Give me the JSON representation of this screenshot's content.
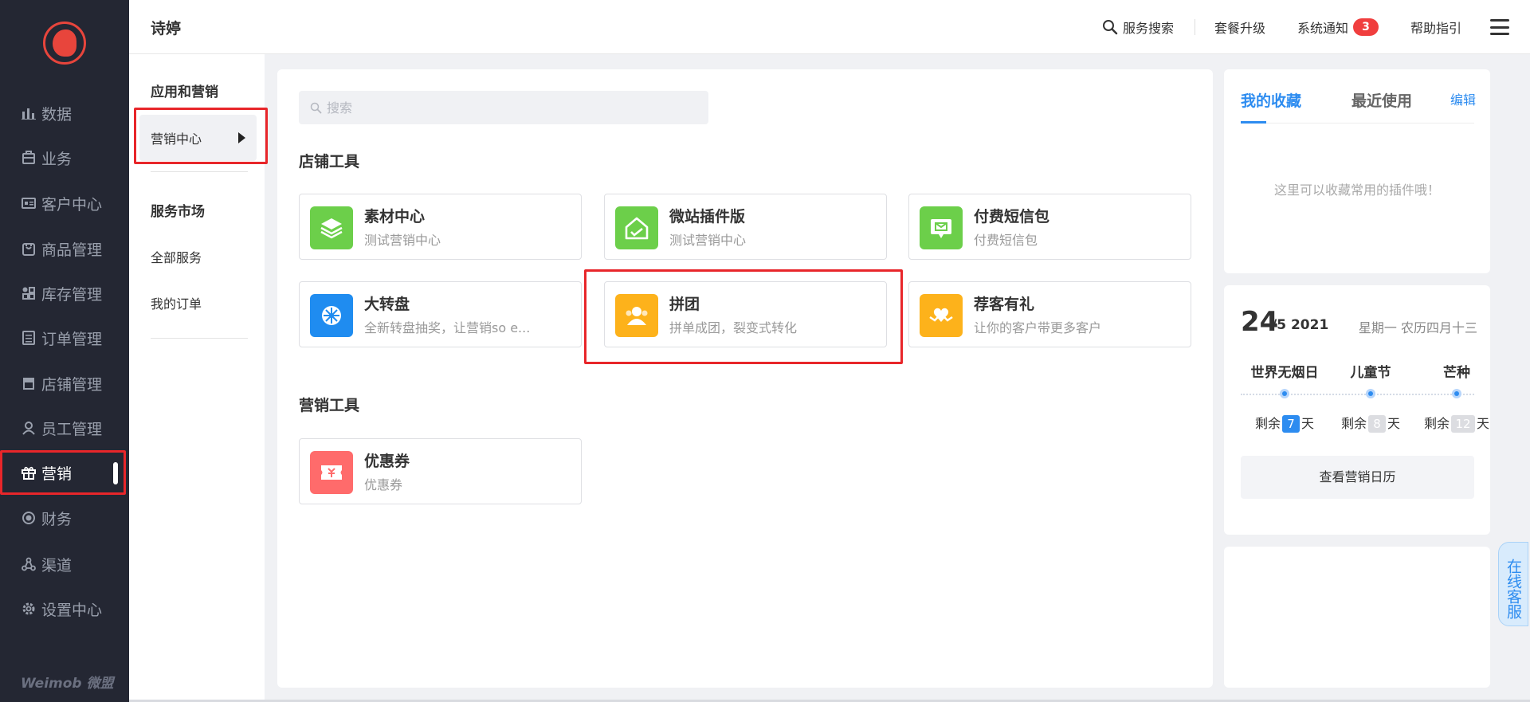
{
  "sidebar": {
    "items": [
      {
        "label": "数据",
        "icon": "bar-chart-icon"
      },
      {
        "label": "业务",
        "icon": "briefcase-icon"
      },
      {
        "label": "客户中心",
        "icon": "id-card-icon"
      },
      {
        "label": "商品管理",
        "icon": "bag-icon"
      },
      {
        "label": "库存管理",
        "icon": "grid-icon"
      },
      {
        "label": "订单管理",
        "icon": "list-icon"
      },
      {
        "label": "店铺管理",
        "icon": "store-icon"
      },
      {
        "label": "员工管理",
        "icon": "person-icon"
      },
      {
        "label": "营销",
        "icon": "gift-icon"
      },
      {
        "label": "财务",
        "icon": "coin-icon"
      },
      {
        "label": "渠道",
        "icon": "channel-icon"
      },
      {
        "label": "设置中心",
        "icon": "gear-icon"
      }
    ],
    "active_label": "营销",
    "brand": "Weimob 微盟"
  },
  "topbar": {
    "shop_name": "诗婷",
    "search_label": "服务搜索",
    "upgrade_label": "套餐升级",
    "notice_label": "系统通知",
    "notice_count": "3",
    "help_label": "帮助指引"
  },
  "subnav": {
    "group1_title": "应用和营销",
    "active_item": "营销中心",
    "group2_title": "服务市场",
    "item_all_services": "全部服务",
    "item_my_orders": "我的订单"
  },
  "main": {
    "search_placeholder": "搜索",
    "section1_title": "店铺工具",
    "section2_title": "营销工具",
    "shop_tools": [
      {
        "name": "素材中心",
        "desc": "测试营销中心",
        "icon": "layers-icon",
        "color": "#6ccf4a"
      },
      {
        "name": "微站插件版",
        "desc": "测试营销中心",
        "icon": "house-icon",
        "color": "#6ccf4a"
      },
      {
        "name": "付费短信包",
        "desc": "付费短信包",
        "icon": "message-icon",
        "color": "#6ccf4a"
      },
      {
        "name": "大转盘",
        "desc": "全新转盘抽奖，让营销so e...",
        "icon": "wheel-icon",
        "color": "#1f8cf0"
      },
      {
        "name": "拼团",
        "desc": "拼单成团，裂变式转化",
        "icon": "group-icon",
        "color": "#fdb21b"
      },
      {
        "name": "荐客有礼",
        "desc": "让你的客户带更多客户",
        "icon": "heart-icon",
        "color": "#fdb21b"
      }
    ],
    "marketing_tools": [
      {
        "name": "优惠券",
        "desc": "优惠券",
        "icon": "coupon-icon",
        "color": "#ff6b6b"
      }
    ]
  },
  "favorites": {
    "tab_mine": "我的收藏",
    "tab_recent": "最近使用",
    "edit": "编辑",
    "empty_text": "这里可以收藏常用的插件哦！"
  },
  "calendar": {
    "day": "24",
    "month_year": "/5 2021",
    "lunar": "星期一 农历四月十三",
    "festivals": [
      {
        "name": "世界无烟日",
        "remain_prefix": "剩余",
        "days": "7",
        "suffix": "天"
      },
      {
        "name": "儿童节",
        "remain_prefix": "剩余",
        "days": "8",
        "suffix": "天"
      },
      {
        "name": "芒种",
        "remain_prefix": "剩余",
        "days": "12",
        "suffix": "天"
      }
    ],
    "button": "查看营销日历"
  },
  "online_service": "在线客服",
  "colors": {
    "accent": "#2d8cf0",
    "sidebar_bg": "#242733",
    "highlight_red": "#e8262a",
    "badge_red": "#f03e3e"
  }
}
